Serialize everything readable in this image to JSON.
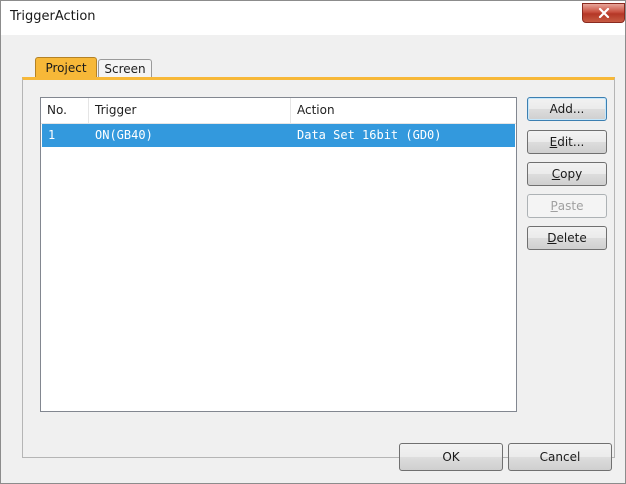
{
  "window": {
    "title": "TriggerAction",
    "close_label": "x"
  },
  "tabs": [
    {
      "label": "Project",
      "selected": true
    },
    {
      "label": "Screen",
      "selected": false
    }
  ],
  "list": {
    "columns": [
      "No.",
      "Trigger",
      "Action"
    ],
    "rows": [
      {
        "no": "1",
        "trigger": "ON(GB40)",
        "action": "Data Set 16bit (GD0)",
        "selected": true
      }
    ]
  },
  "side_buttons": {
    "add": "Add...",
    "edit_mnemonic": "E",
    "edit_rest": "dit...",
    "copy_mnemonic": "C",
    "copy_rest": "opy",
    "paste_mnemonic": "P",
    "paste_rest": "aste",
    "delete_mnemonic": "D",
    "delete_rest": "elete"
  },
  "footer": {
    "ok": "OK",
    "cancel": "Cancel"
  },
  "colors": {
    "selected_tab": "#f7b838",
    "selection": "#3399dd",
    "close_button": "#c75b43"
  }
}
